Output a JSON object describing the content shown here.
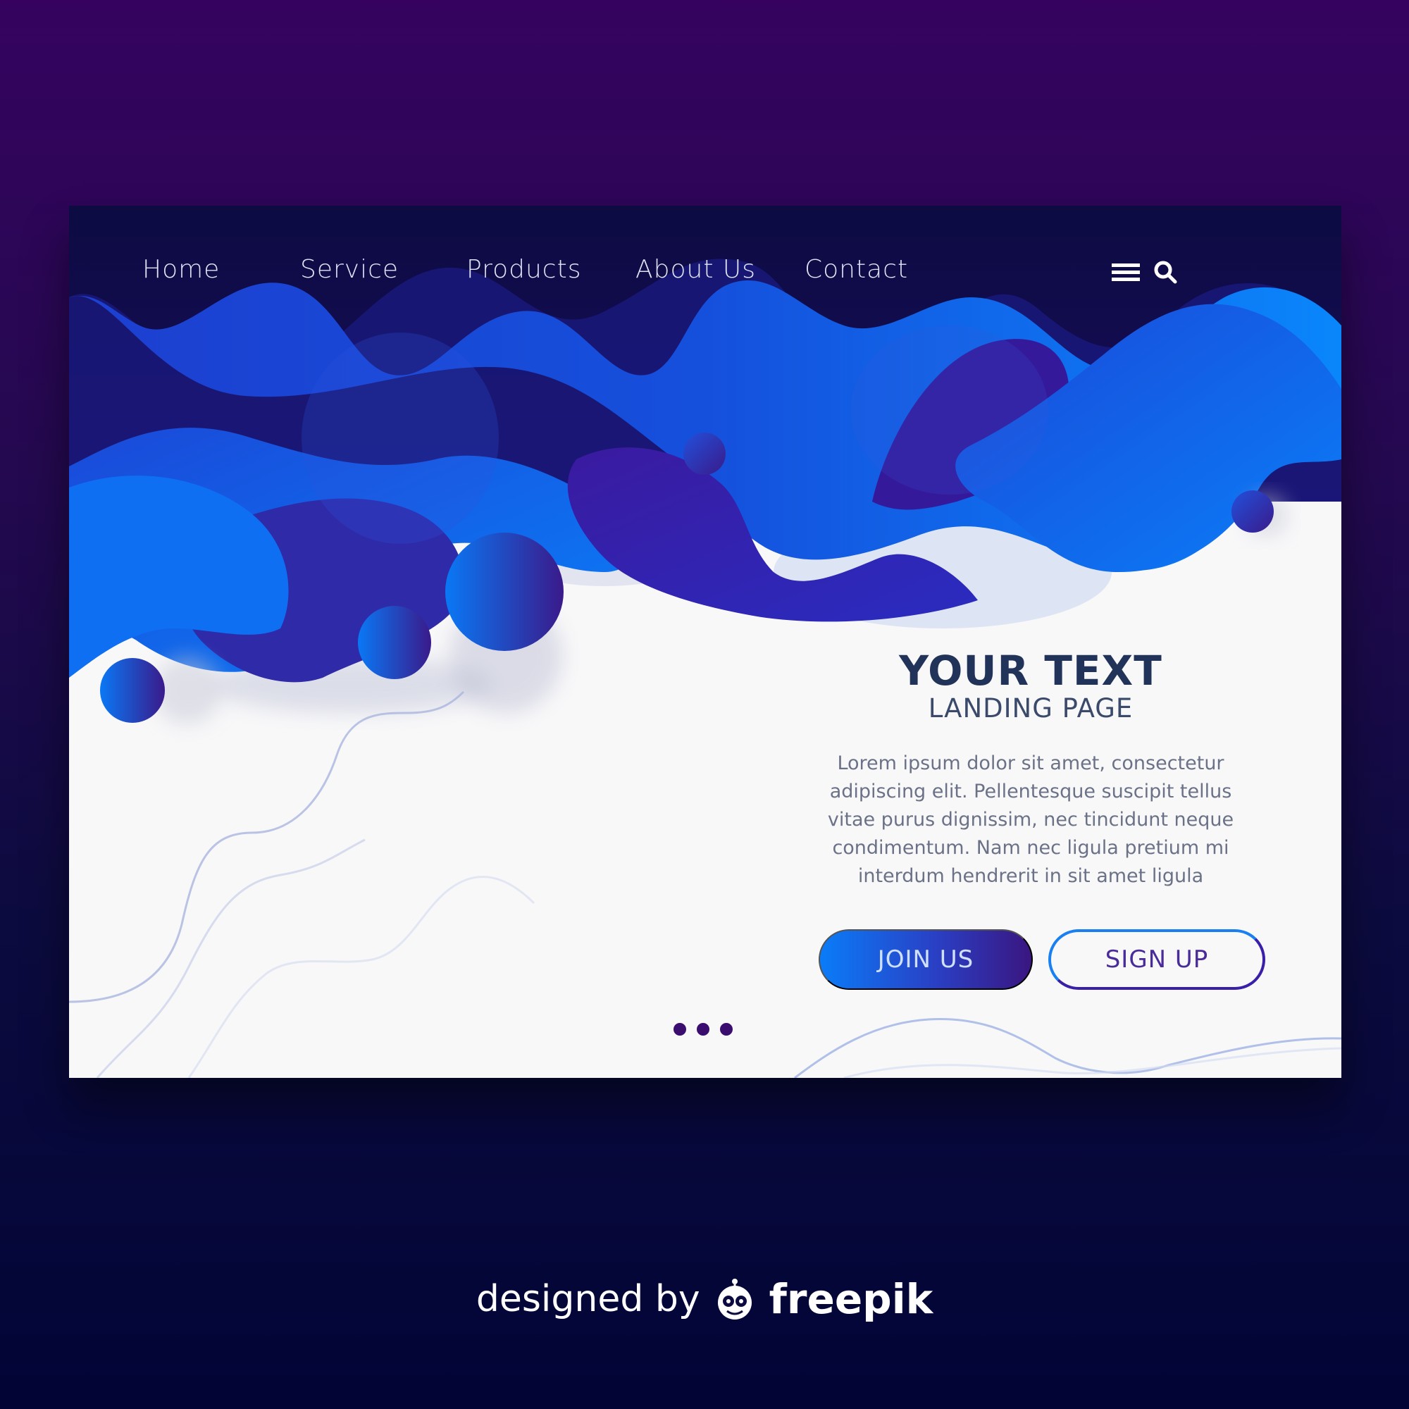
{
  "nav": {
    "items": [
      {
        "label": "Home"
      },
      {
        "label": "Service"
      },
      {
        "label": "Products"
      },
      {
        "label": "About Us"
      },
      {
        "label": "Contact"
      }
    ],
    "icons": [
      "menu-icon",
      "search-icon"
    ]
  },
  "hero": {
    "title": "YOUR TEXT",
    "subtitle": "LANDING PAGE",
    "body": "Lorem ipsum dolor sit amet, consectetur adipiscing elit. Pellentesque suscipit tellus vitae purus dignissim, nec tincidunt neque condimentum. Nam nec ligula pretium mi interdum hendrerit in sit amet ligula"
  },
  "buttons": {
    "join_label": "JOIN US",
    "signup_label": "SIGN UP"
  },
  "pagination": {
    "dot_count": 3
  },
  "footer": {
    "prefix": "designed by",
    "brand": "freepik",
    "brand_icon": "freepik-logo-icon"
  },
  "colors": {
    "page_bg_top": "#35035f",
    "page_bg_bottom": "#020436",
    "card_bg": "#f8f8f9",
    "nav_bg": "#0d0b45",
    "wave_blue": "#0a6ff0",
    "wave_purple": "#3a1a9a",
    "title_text": "#22335a",
    "dot": "#3a0d6e"
  }
}
